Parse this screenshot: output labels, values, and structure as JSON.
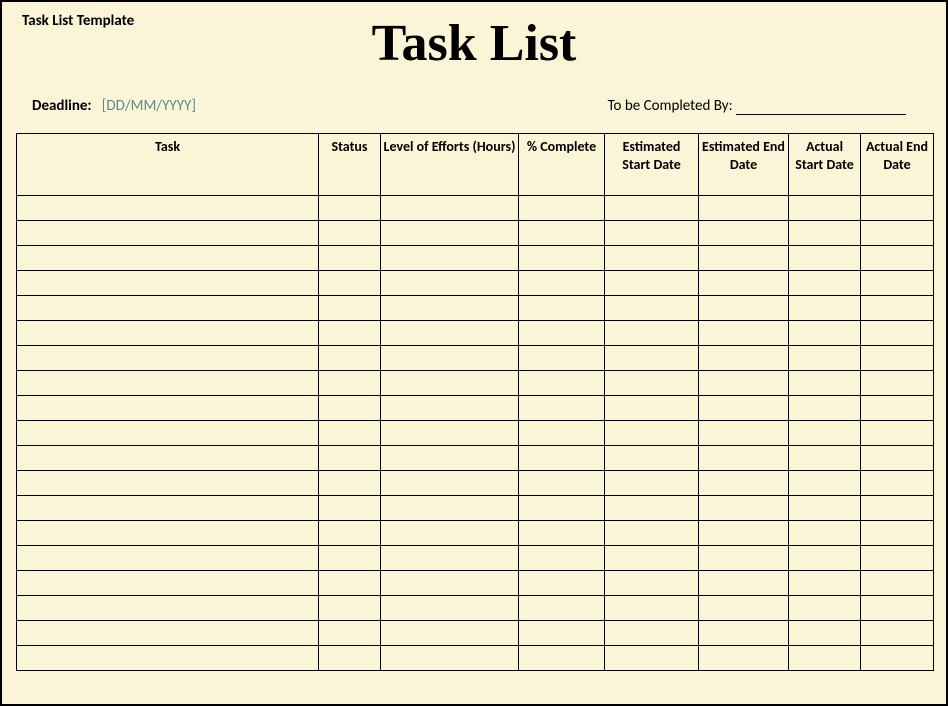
{
  "header": {
    "template_label": "Task List Template",
    "title": "Task List"
  },
  "meta": {
    "deadline_label": "Deadline:",
    "deadline_placeholder": "[DD/MM/YYYY]",
    "completed_by_label": "To be Completed  By:"
  },
  "columns": [
    "Task",
    "Status",
    "Level of Efforts (Hours)",
    "% Complete",
    "Estimated Start Date",
    "Estimated End Date",
    "Actual Start Date",
    "Actual End Date"
  ],
  "rows": [
    [
      "",
      "",
      "",
      "",
      "",
      "",
      "",
      ""
    ],
    [
      "",
      "",
      "",
      "",
      "",
      "",
      "",
      ""
    ],
    [
      "",
      "",
      "",
      "",
      "",
      "",
      "",
      ""
    ],
    [
      "",
      "",
      "",
      "",
      "",
      "",
      "",
      ""
    ],
    [
      "",
      "",
      "",
      "",
      "",
      "",
      "",
      ""
    ],
    [
      "",
      "",
      "",
      "",
      "",
      "",
      "",
      ""
    ],
    [
      "",
      "",
      "",
      "",
      "",
      "",
      "",
      ""
    ],
    [
      "",
      "",
      "",
      "",
      "",
      "",
      "",
      ""
    ],
    [
      "",
      "",
      "",
      "",
      "",
      "",
      "",
      ""
    ],
    [
      "",
      "",
      "",
      "",
      "",
      "",
      "",
      ""
    ],
    [
      "",
      "",
      "",
      "",
      "",
      "",
      "",
      ""
    ],
    [
      "",
      "",
      "",
      "",
      "",
      "",
      "",
      ""
    ],
    [
      "",
      "",
      "",
      "",
      "",
      "",
      "",
      ""
    ],
    [
      "",
      "",
      "",
      "",
      "",
      "",
      "",
      ""
    ],
    [
      "",
      "",
      "",
      "",
      "",
      "",
      "",
      ""
    ],
    [
      "",
      "",
      "",
      "",
      "",
      "",
      "",
      ""
    ],
    [
      "",
      "",
      "",
      "",
      "",
      "",
      "",
      ""
    ],
    [
      "",
      "",
      "",
      "",
      "",
      "",
      "",
      ""
    ],
    [
      "",
      "",
      "",
      "",
      "",
      "",
      "",
      ""
    ]
  ]
}
